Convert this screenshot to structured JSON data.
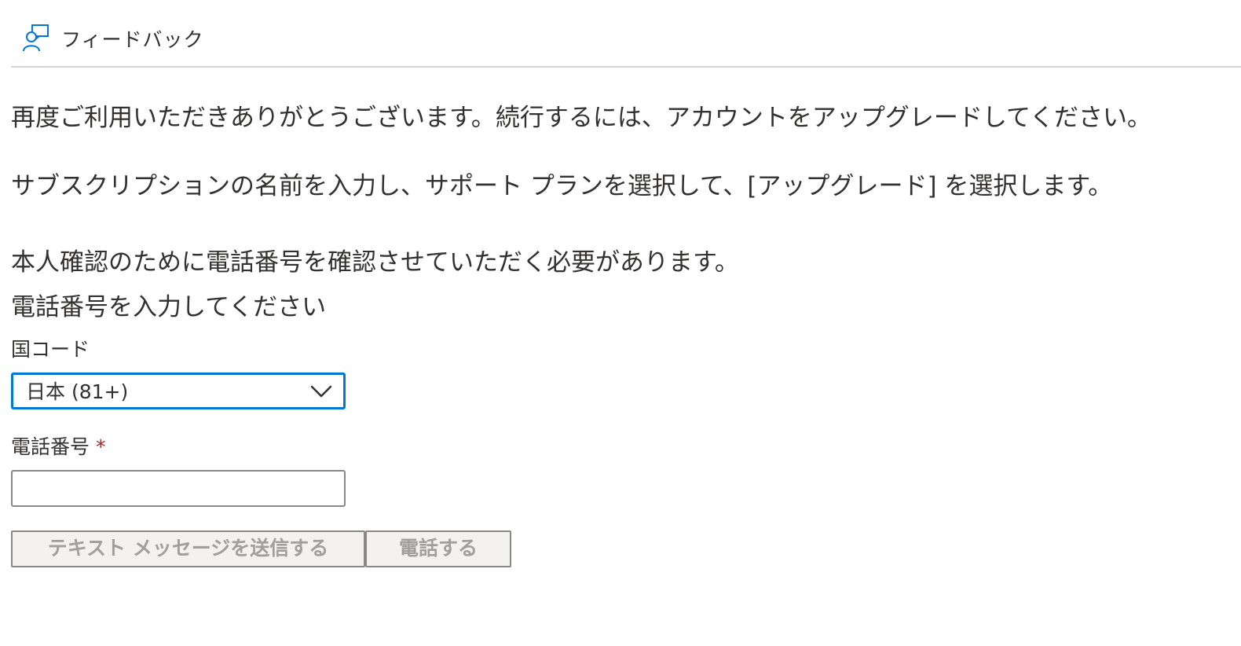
{
  "header": {
    "feedback_label": "フィードバック",
    "feedback_icon": "person-feedback-icon"
  },
  "content": {
    "paragraph1": "再度ご利用いただきありがとうございます。続行するには、アカウントをアップグレードしてください。",
    "paragraph2": "サブスクリプションの名前を入力し、サポート プランを選択して、[アップグレード] を選択します。",
    "paragraph3": "本人確認のために電話番号を確認させていただく必要があります。",
    "paragraph4": "電話番号を入力してください"
  },
  "form": {
    "country_code": {
      "label": "国コード",
      "selected_value": "日本 (81+)",
      "icon": "chevron-down-icon"
    },
    "phone_number": {
      "label": "電話番号",
      "required_marker": "*",
      "value": "",
      "placeholder": ""
    },
    "buttons": {
      "send_text_label": "テキスト メッセージを送信する",
      "call_label": "電話する"
    }
  },
  "colors": {
    "accent": "#0078d4",
    "required": "#a4262c",
    "disabled_text": "#a19f9d",
    "disabled_bg": "#f3f2f1"
  }
}
